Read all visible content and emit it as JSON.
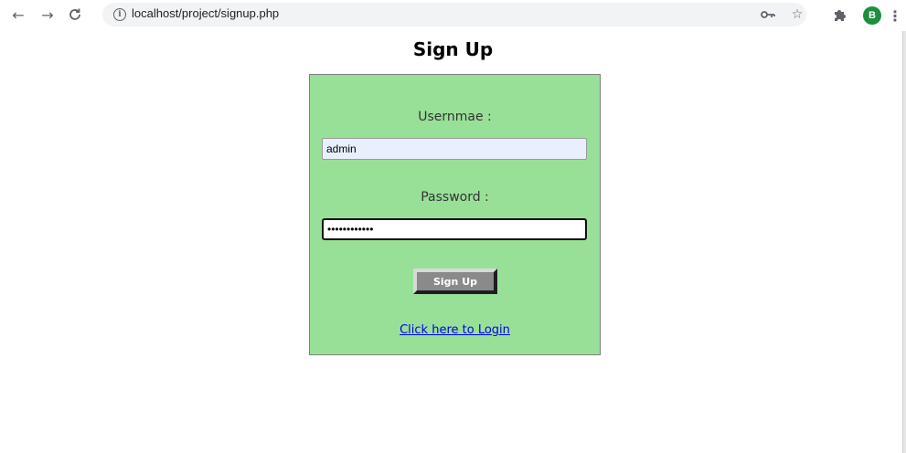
{
  "browser": {
    "url": "localhost/project/signup.php",
    "profile_initial": "B",
    "icons": [
      "back-icon",
      "forward-icon",
      "reload-icon",
      "info-icon",
      "key-icon",
      "star-icon",
      "puzzle-icon",
      "menu-icon"
    ]
  },
  "page": {
    "title": "Sign Up",
    "username_label": "Usernmae :",
    "username_value": "admin",
    "password_label": "Password :",
    "password_value": "••••••••••••",
    "submit_label": "Sign Up",
    "login_link": "Click here to Login"
  },
  "colors": {
    "form_background": "#98e098",
    "button_background": "#8a8a8a",
    "link": "#0000ee",
    "autofill_background": "#e8f0fe"
  }
}
